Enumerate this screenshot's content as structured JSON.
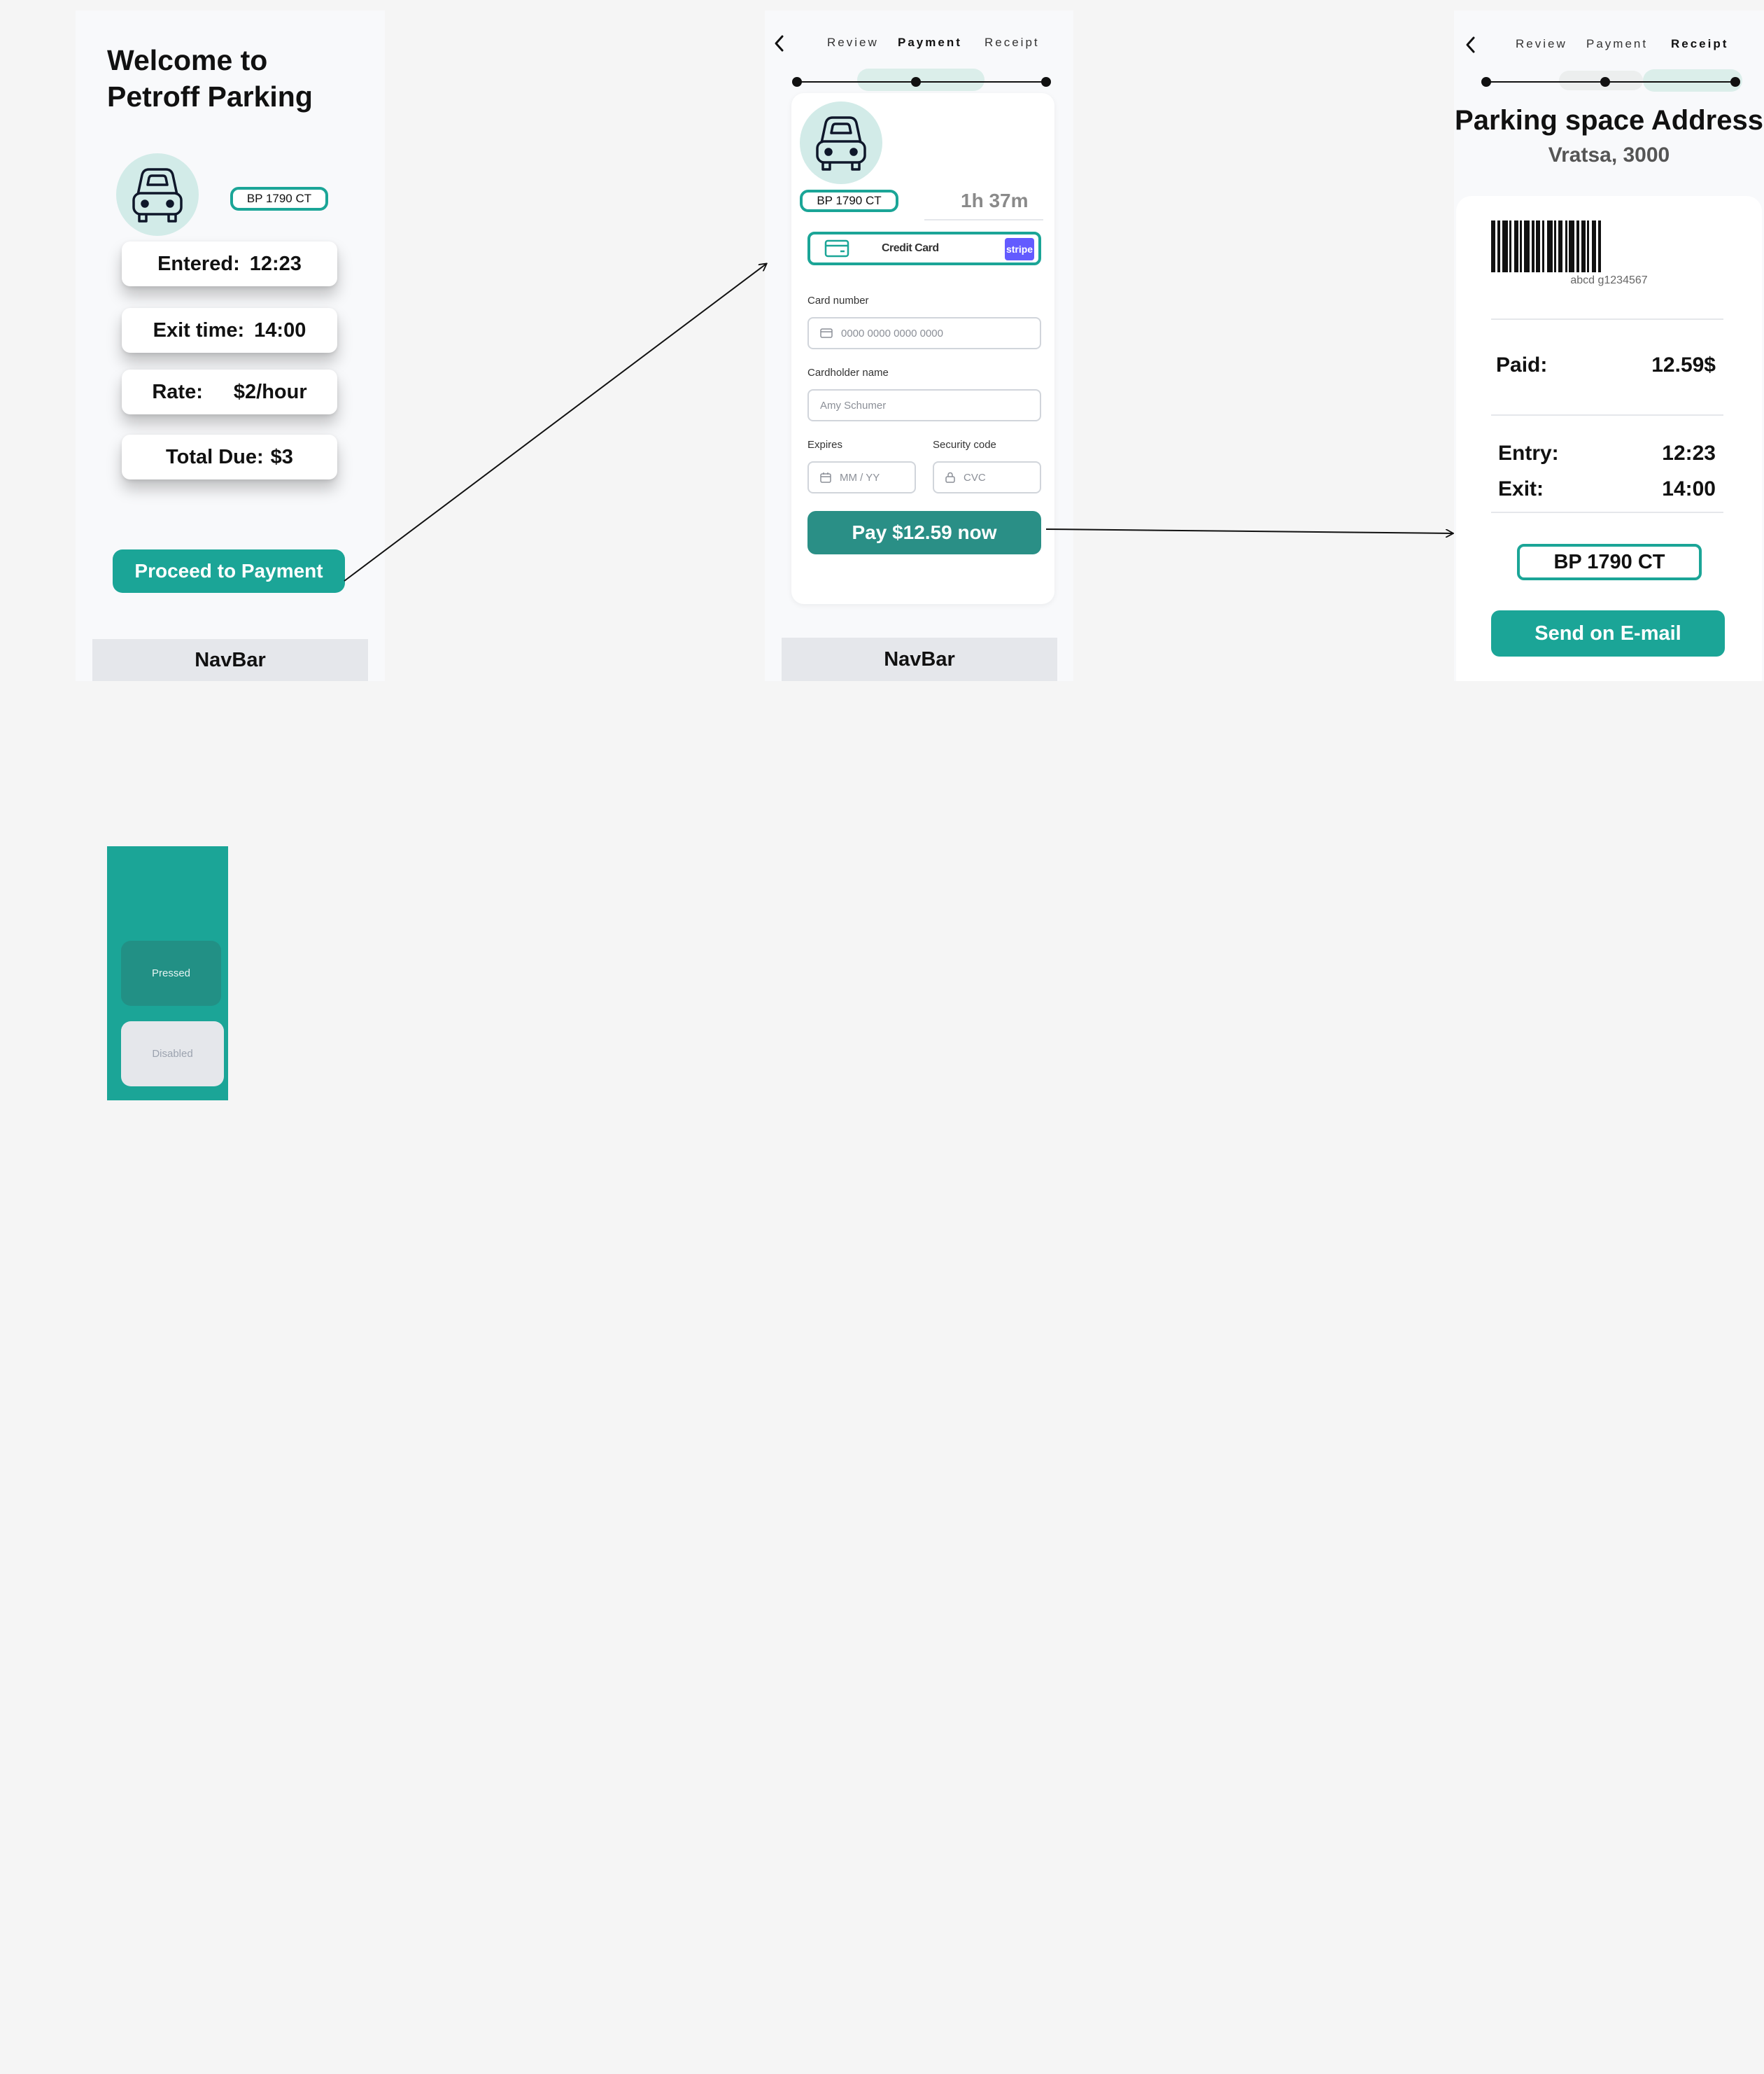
{
  "review": {
    "title_line1": "Welcome to",
    "title_line2": "Petroff Parking",
    "plate": "BP 1790 CT",
    "entered_label": "Entered:",
    "entered_value": "12:23",
    "exit_label": "Exit time:",
    "exit_value": "14:00",
    "rate_label": "Rate:",
    "rate_value": "$2/hour",
    "total_label": "Total Due:",
    "total_value": "$3",
    "proceed_button": "Proceed to Payment",
    "navbar": "NavBar"
  },
  "payment": {
    "steps": [
      "Review",
      "Payment",
      "Receipt"
    ],
    "active_step": "Payment",
    "plate": "BP 1790 CT",
    "duration": "1h 37m",
    "method_label": "Credit Card",
    "stripe_badge": "stripe",
    "card_number_label": "Card number",
    "card_number_placeholder": "0000 0000 0000 0000",
    "cardholder_label": "Cardholder name",
    "cardholder_placeholder": "Amy Schumer",
    "expires_label": "Expires",
    "expires_placeholder": "MM / YY",
    "security_label": "Security code",
    "security_placeholder": "CVC",
    "pay_button": "Pay $12.59 now",
    "navbar": "NavBar"
  },
  "receipt": {
    "steps": [
      "Review",
      "Payment",
      "Receipt"
    ],
    "active_step": "Receipt",
    "address_title": "Parking space Address",
    "address_city": "Vratsa, 3000",
    "barcode_text": "abcd  g1234567",
    "paid_label": "Paid:",
    "paid_value": "12.59$",
    "entry_label": "Entry:",
    "entry_value": "12:23",
    "exit_label": "Exit:",
    "exit_value": "14:00",
    "plate": "BP 1790 CT",
    "email_button": "Send on E-mail"
  },
  "button_states": {
    "pressed": "Pressed",
    "disabled": "Disabled"
  },
  "colors": {
    "accent": "#1ba597",
    "accent_pressed": "#229085",
    "pay_button": "#2a8f86",
    "stripe": "#635bff",
    "car_circle": "#d2ebe8",
    "canvas": "#f5f5f5"
  }
}
